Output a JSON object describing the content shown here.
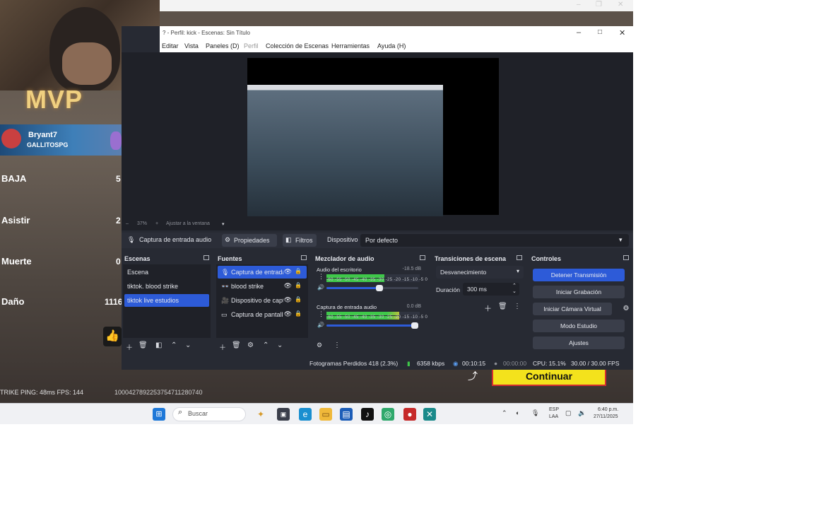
{
  "game": {
    "mvp": "MVP",
    "player_name": "Bryant7",
    "team_tag": "GALLITOSPG",
    "stats": [
      {
        "label": "BAJA",
        "value": "5"
      },
      {
        "label": "Asistir",
        "value": "2"
      },
      {
        "label": "Muerte",
        "value": "0"
      },
      {
        "label": "Daño",
        "value": "1116"
      }
    ],
    "ping_line": "TRIKE  PING: 48ms  FPS: 144",
    "game_id": "1000427892253754711280740",
    "continue_label": "Continuar"
  },
  "obs": {
    "title": "? - Perfil: kick - Escenas: Sin Título",
    "window_controls": {
      "min": "–",
      "max": "□",
      "close": "✕"
    },
    "menu": [
      "Editar",
      "Vista",
      "Paneles (D)",
      "Perfil",
      "Colección de Escenas",
      "Herramientas",
      "Ayuda (H)"
    ],
    "zoom": {
      "minus": "–",
      "percent": "37%",
      "plus": "+",
      "fit": "Ajustar a la ventana",
      "arrow": "▾"
    },
    "toolbar": {
      "source_name": "Captura de entrada audio",
      "properties": "Propiedades",
      "filters": "Filtros",
      "device_label": "Dispositivo",
      "device_value": "Por defecto"
    },
    "docks": {
      "scenes": {
        "title": "Escenas",
        "items": [
          "Escena",
          "tiktok. blood strike",
          "tiktok live estudios"
        ],
        "selected": 2
      },
      "sources": {
        "title": "Fuentes",
        "items": [
          {
            "icon": "🎙",
            "label": "Captura de entrada audio"
          },
          {
            "icon": "👓",
            "label": "blood strike"
          },
          {
            "icon": "🎥",
            "label": "Dispositivo de captura"
          },
          {
            "icon": "▭",
            "label": "Captura de pantalla"
          }
        ],
        "selected": 0
      },
      "mixer": {
        "title": "Mezclador de audio",
        "channels": [
          {
            "name": "Audio del escritorio",
            "db": "-18.5 dB",
            "level": 0.62,
            "volume": 0.58
          },
          {
            "name": "Captura de entrada audio",
            "db": "0.0 dB",
            "level": 0.78,
            "volume": 0.96
          }
        ],
        "scale": "-60 -55 -50 -45 -40 -35 -30 -25 -20 -15 -10 -5 0"
      },
      "transitions": {
        "title": "Transiciones de escena",
        "type": "Desvanecimiento",
        "duration_label": "Duración",
        "duration_value": "300 ms"
      },
      "controls": {
        "title": "Controles",
        "stop_stream": "Detener Transmisión",
        "start_recording": "Iniciar Grabación",
        "start_vcam": "Iniciar Cámara Virtual",
        "studio_mode": "Modo Estudio",
        "settings": "Ajustes"
      }
    },
    "status": {
      "dropped": "Fotogramas Perdidos 418 (2.3%)",
      "bitrate": "6358 kbps",
      "stream_time": "00:10:15",
      "rec_time": "00:00:00",
      "cpu": "CPU: 15.1%",
      "fps": "30.00 / 30.00 FPS"
    }
  },
  "taskbar": {
    "search_placeholder": "Buscar",
    "lang_top": "ESP",
    "lang_bottom": "LAA",
    "time": "6:40 p.m.",
    "date": "27/11/2025"
  },
  "colors": {
    "accent": "#2d5bd8",
    "obs_bg": "#272a33",
    "continue_yellow": "#f3e21c",
    "meter_green": "#3fc84a",
    "meter_yellow": "#c8c23a",
    "meter_red": "#c83a3a"
  }
}
